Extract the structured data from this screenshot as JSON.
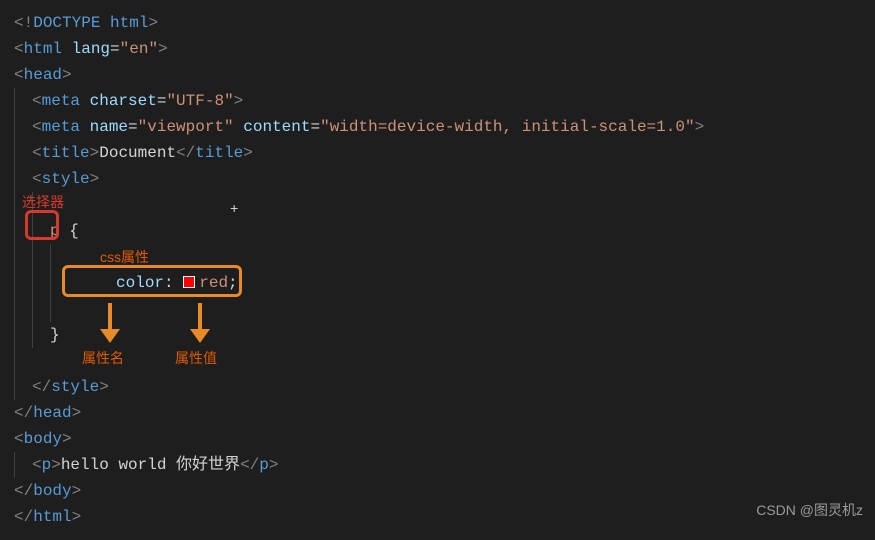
{
  "doctype": {
    "open": "<",
    "bang": "!",
    "word": "DOCTYPE html",
    "close": ">"
  },
  "tags": {
    "html_open": {
      "b1": "<",
      "name": "html ",
      "attr": "lang",
      "eq": "=",
      "val": "\"en\"",
      "b2": ">"
    },
    "head_open": {
      "b1": "<",
      "name": "head",
      "b2": ">"
    },
    "meta_charset": {
      "b1": "<",
      "name": "meta ",
      "attr": "charset",
      "eq": "=",
      "val": "\"UTF-8\"",
      "b2": ">"
    },
    "meta_viewport": {
      "b1": "<",
      "name": "meta ",
      "attr1": "name",
      "eq1": "=",
      "val1": "\"viewport\"",
      "sp": " ",
      "attr2": "content",
      "eq2": "=",
      "val2": "\"width=device-width, initial-scale=1.0\"",
      "b2": ">"
    },
    "title": {
      "b1": "<",
      "name1": "title",
      "b2": ">",
      "text": "Document",
      "b3": "<",
      "slash": "/",
      "name2": "title",
      "b4": ">"
    },
    "style_open": {
      "b1": "<",
      "name": "style",
      "b2": ">"
    },
    "style_close": {
      "b1": "<",
      "slash": "/",
      "name": "style",
      "b2": ">"
    },
    "head_close": {
      "b1": "<",
      "slash": "/",
      "name": "head",
      "b2": ">"
    },
    "body_open": {
      "b1": "<",
      "name": "body",
      "b2": ">"
    },
    "p_tag": {
      "b1": "<",
      "name1": "p",
      "b2": ">",
      "text": "hello world 你好世界",
      "b3": "<",
      "slash": "/",
      "name2": "p",
      "b4": ">"
    },
    "body_close": {
      "b1": "<",
      "slash": "/",
      "name": "body",
      "b2": ">"
    },
    "html_close": {
      "b1": "<",
      "slash": "/",
      "name": "html",
      "b2": ">"
    }
  },
  "css": {
    "selector": "p",
    "brace_open": " {",
    "prop": "color",
    "colon": ": ",
    "value": "red",
    "semi": ";",
    "brace_close": "}"
  },
  "annotations": {
    "selector_label": "选择器",
    "css_prop_label": "css属性",
    "prop_name_label": "属性名",
    "prop_value_label": "属性值"
  },
  "watermark": "CSDN @图灵机z",
  "cursor": "+"
}
